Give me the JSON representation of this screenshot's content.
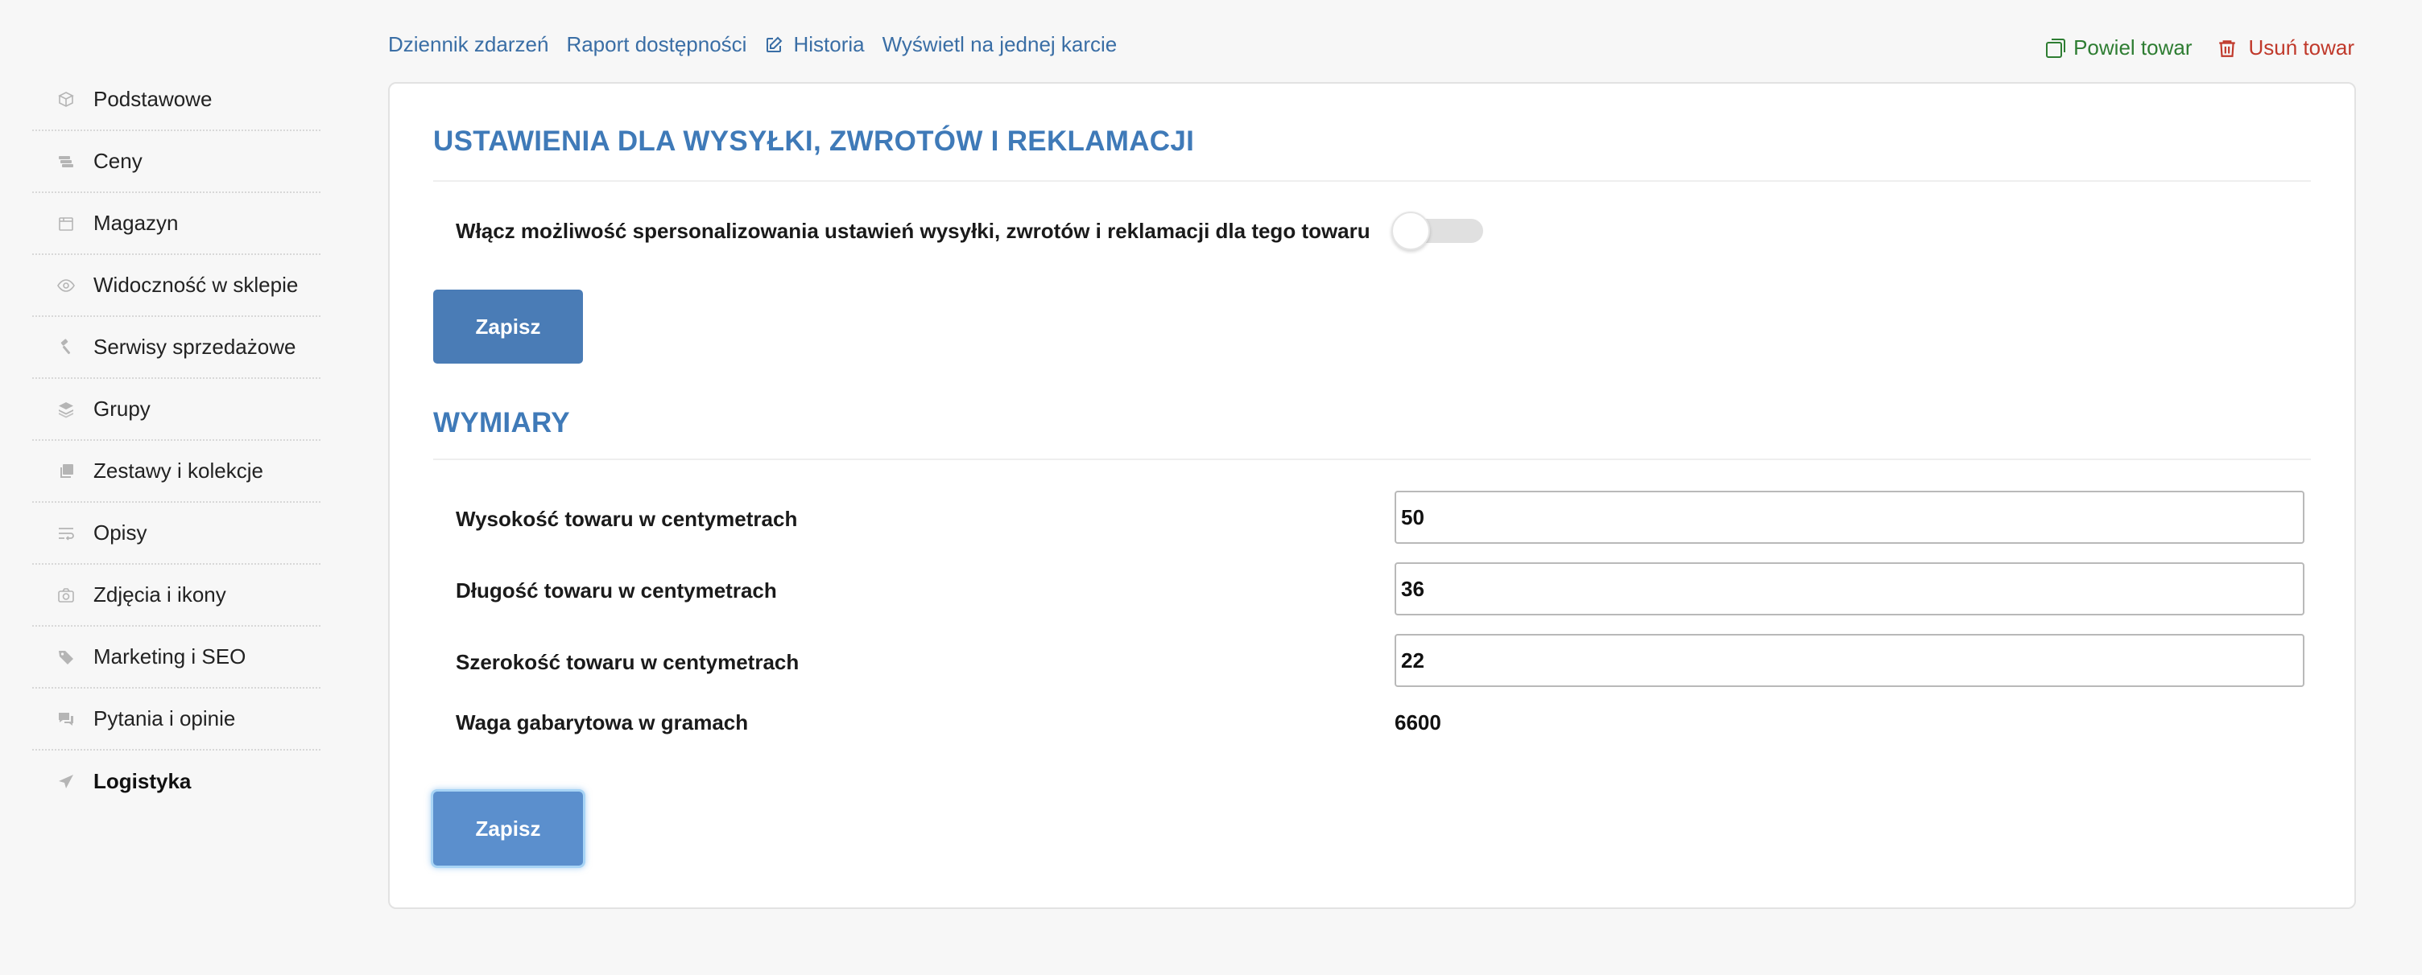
{
  "sidebar": {
    "items": [
      {
        "label": "Podstawowe",
        "icon": "box-icon"
      },
      {
        "label": "Ceny",
        "icon": "money-icon"
      },
      {
        "label": "Magazyn",
        "icon": "warehouse-icon"
      },
      {
        "label": "Widoczność w sklepie",
        "icon": "eye-icon"
      },
      {
        "label": "Serwisy sprzedażowe",
        "icon": "gavel-icon"
      },
      {
        "label": "Grupy",
        "icon": "layers-icon"
      },
      {
        "label": "Zestawy i kolekcje",
        "icon": "collection-icon"
      },
      {
        "label": "Opisy",
        "icon": "text-wrap-icon"
      },
      {
        "label": "Zdjęcia i ikony",
        "icon": "camera-icon"
      },
      {
        "label": "Marketing i SEO",
        "icon": "tags-icon"
      },
      {
        "label": "Pytania i opinie",
        "icon": "comments-icon"
      },
      {
        "label": "Logistyka",
        "icon": "paper-plane-icon"
      }
    ]
  },
  "topnav": {
    "event_log": "Dziennik zdarzeń",
    "availability_report": "Raport dostępności",
    "history": "Historia",
    "single_card": "Wyświetl na jednej karcie"
  },
  "actions": {
    "duplicate": "Powiel towar",
    "delete": "Usuń towar"
  },
  "shipping": {
    "title": "USTAWIENIA DLA WYSYŁKI, ZWROTÓW I REKLAMACJI",
    "toggle_label": "Włącz możliwość spersonalizowania ustawień wysyłki, zwrotów i reklamacji dla tego towaru",
    "save": "Zapisz"
  },
  "dimensions": {
    "title": "WYMIARY",
    "height_label": "Wysokość towaru w centymetrach",
    "height_value": "50",
    "length_label": "Długość towaru w centymetrach",
    "length_value": "36",
    "width_label": "Szerokość towaru w centymetrach",
    "width_value": "22",
    "weight_label": "Waga gabarytowa w gramach",
    "weight_value": "6600",
    "save": "Zapisz"
  },
  "colors": {
    "accent": "#3f7ab8",
    "button": "#4a7cb6",
    "duplicate": "#2e7d32",
    "delete": "#c0392b"
  }
}
